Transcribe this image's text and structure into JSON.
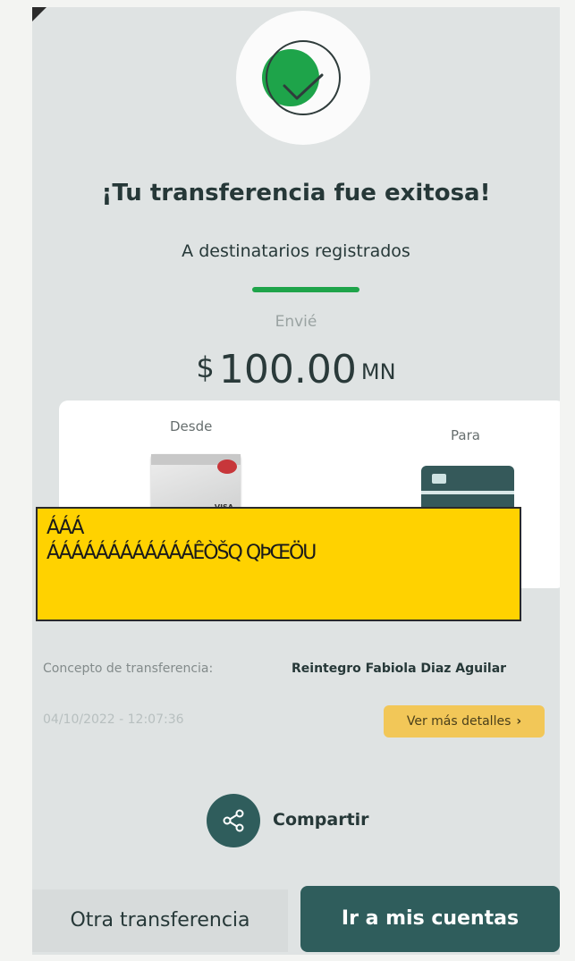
{
  "success_message": {
    "title": "¡Tu transferencia fue exitosa!",
    "subtitle": "A destinatarios registrados"
  },
  "amount": {
    "label": "Envié",
    "currency_symbol": "$",
    "value": "100.00",
    "unit": "MN"
  },
  "cards": {
    "from_label": "Desde",
    "to_label": "Para",
    "from_brand": "VISA"
  },
  "redaction": {
    "line1": "ÁÁÁ",
    "line2": "ÁÁÁÁÁÁÁÁÁÁÁÁÊÒŠQ QÞŒÖU"
  },
  "concept": {
    "label": "Concepto de transferencia:",
    "value": "Reintegro Fabiola Diaz Aguilar"
  },
  "datetime": "04/10/2022 - 12:07:36",
  "details_button": {
    "label": "Ver más detalles",
    "chevron": "›"
  },
  "share": {
    "label": "Compartir",
    "icon": "share-icon"
  },
  "buttons": {
    "other_transfer": "Otra transferencia",
    "my_accounts": "Ir a mis cuentas"
  },
  "colors": {
    "accent_green": "#1ea44a",
    "primary_teal": "#2f5d5c",
    "highlight_yellow": "#f2c758",
    "background": "#dfe3e3"
  }
}
